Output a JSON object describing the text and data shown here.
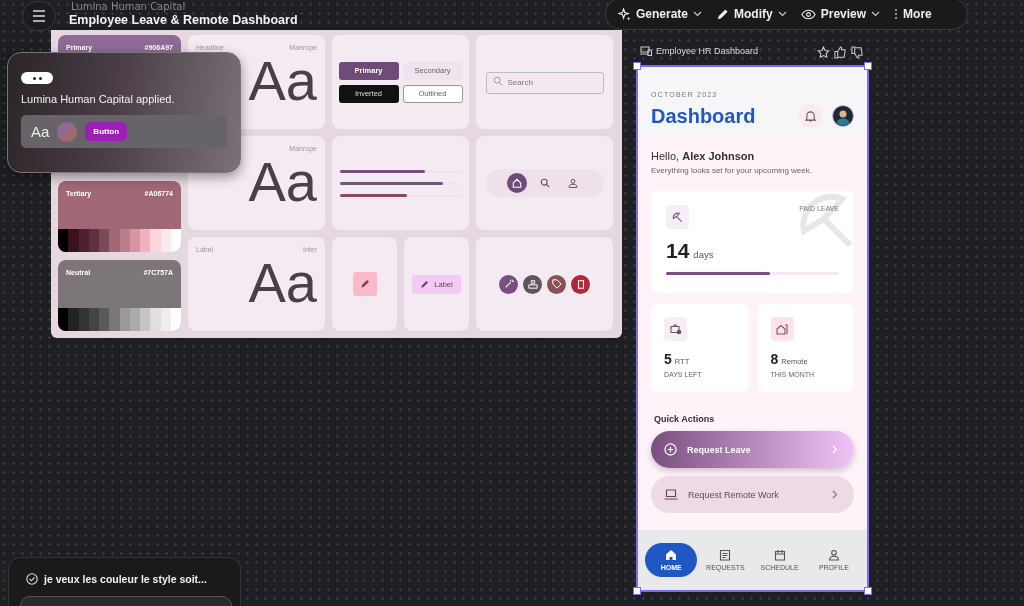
{
  "app": {
    "project": "Lumina Human Capital",
    "title": "Employee Leave & Remote Dashboard"
  },
  "toolbar": [
    {
      "label": "Generate",
      "kind": "sparkle",
      "caret": true
    },
    {
      "label": "Modify",
      "kind": "pencil",
      "caret": true
    },
    {
      "label": "Preview",
      "kind": "eye",
      "caret": true
    },
    {
      "label": "More",
      "kind": "dots",
      "caret": false
    }
  ],
  "design_system": {
    "colors": [
      {
        "name": "Primary",
        "hex": "#906A97",
        "color": "#906a97"
      },
      {
        "name": "Tertiary",
        "hex": "#A06774",
        "color": "#a06774"
      },
      {
        "name": "Neutral",
        "hex": "#7C757A",
        "color": "#7c757a"
      }
    ],
    "type_styles": [
      {
        "role": "Headline",
        "font": "Manrope",
        "sample": "Aa"
      },
      {
        "font": "Manrope",
        "sample": "Aa"
      },
      {
        "role": "Label",
        "font": "Inter",
        "sample": "Aa"
      }
    ],
    "buttons": [
      {
        "label": "Primary",
        "kind": "primary"
      },
      {
        "label": "Secondary",
        "kind": "secondary"
      },
      {
        "label": "Inverted",
        "kind": "inverted"
      },
      {
        "label": "Outlined",
        "kind": "outlined"
      }
    ],
    "search": {
      "placeholder": "Search"
    },
    "progress": [
      {
        "level": 0.7,
        "color": "#7a4f80"
      },
      {
        "level": 0.85,
        "color": "#6b5a6c"
      },
      {
        "level": 0.55,
        "color": "#8a4a57"
      }
    ],
    "nav_icons": [
      {
        "kind": "home",
        "selected": true
      },
      {
        "kind": "search",
        "selected": false
      },
      {
        "kind": "person",
        "selected": false
      }
    ],
    "chip": {
      "label": "Label"
    },
    "round_icons": [
      {
        "kind": "wand",
        "color": "#7a4f80"
      },
      {
        "kind": "stack",
        "color": "#5f5560"
      },
      {
        "kind": "tag",
        "color": "#8a5058"
      },
      {
        "kind": "trash",
        "color": "#b0283a"
      }
    ]
  },
  "toast": {
    "message": "Lumina Human Capital applied.",
    "sample": "Aa",
    "button": "Button"
  },
  "phone": {
    "frame_title": "Employee HR Dashboard",
    "month": "OCTOBER 2023",
    "title": "Dashboard",
    "greeting": "Hello, **Alex Johnson**",
    "subtitle": "Everything looks set for your upcoming week.",
    "leave": {
      "label": "PAID LEAVE",
      "value": "14",
      "unit": "days",
      "level": 0.6
    },
    "stats": [
      {
        "kind": "briefcase",
        "value": "5",
        "unit": "RTT",
        "caption": "DAYS LEFT"
      },
      {
        "kind": "house",
        "value": "8",
        "unit": "Remote",
        "caption": "THIS MONTH"
      }
    ],
    "quick_actions_title": "Quick Actions",
    "actions": [
      {
        "label": "Request Leave",
        "kind": "primary"
      },
      {
        "label": "Request Remote Work",
        "kind": "secondary"
      }
    ],
    "nav": [
      {
        "label": "HOME",
        "kind": "home",
        "selected": true
      },
      {
        "label": "REQUESTS",
        "kind": "requests",
        "selected": false
      },
      {
        "label": "SCHEDULE",
        "kind": "calendar",
        "selected": false
      },
      {
        "label": "PROFILE",
        "kind": "person",
        "selected": false
      }
    ]
  },
  "chat": {
    "message": "je veux les couleur le style soit..."
  }
}
